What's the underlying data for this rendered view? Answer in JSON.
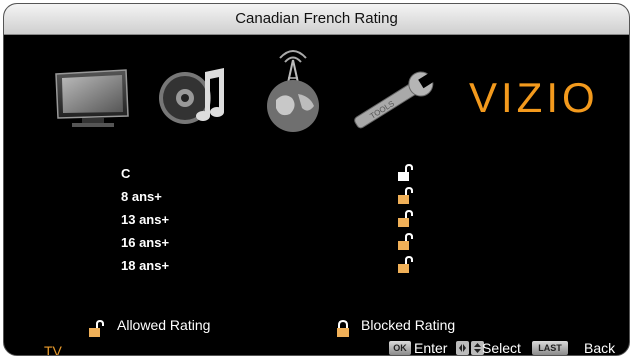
{
  "title": "Canadian French Rating",
  "brand": "VIZIO",
  "menu_icons": [
    "tv-icon",
    "music-icon",
    "globe-antenna-icon",
    "tools-wrench-icon"
  ],
  "ratings": [
    {
      "label": "C",
      "state": "allowed",
      "selected": true
    },
    {
      "label": "8 ans+",
      "state": "allowed",
      "selected": false
    },
    {
      "label": "13 ans+",
      "state": "allowed",
      "selected": false
    },
    {
      "label": "16 ans+",
      "state": "allowed",
      "selected": false
    },
    {
      "label": "18 ans+",
      "state": "allowed",
      "selected": false
    }
  ],
  "legend": {
    "allowed": "Allowed Rating",
    "blocked": "Blocked Rating"
  },
  "source": "TV",
  "footer": {
    "ok_key": "OK",
    "enter": "Enter",
    "select": "Select",
    "last_key": "LAST",
    "back": "Back"
  },
  "colors": {
    "accent": "#f39a1d",
    "lock_body": "#f0b058",
    "background": "#000000"
  }
}
